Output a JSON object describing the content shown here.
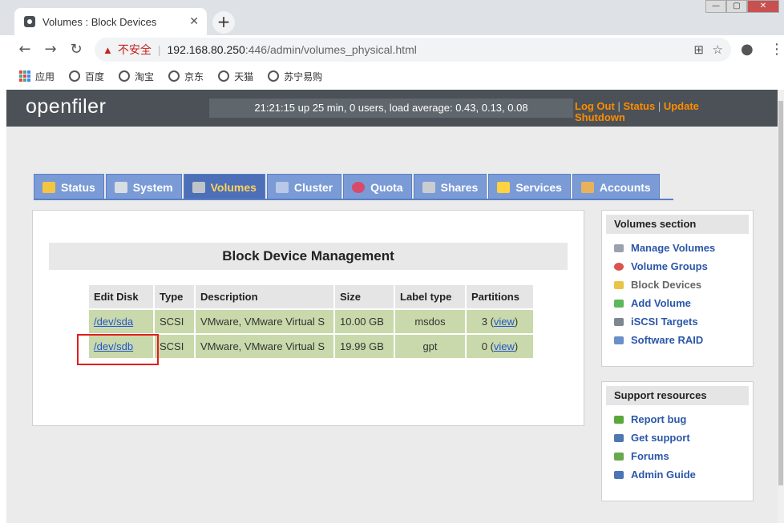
{
  "browser": {
    "tab_title": "Volumes : Block Devices",
    "tab_close": "✕",
    "new_tab": "+",
    "window_buttons": [
      "—",
      "▢",
      "✕"
    ],
    "nav": {
      "back": "←",
      "forward": "→",
      "reload": "↻"
    },
    "address": {
      "insecure_label": "不安全",
      "separator": "|",
      "host": "192.168.80.250",
      "rest": ":446/admin/volumes_physical.html"
    },
    "bookmarks": [
      {
        "label": "应用",
        "icon": "apps-icon"
      },
      {
        "label": "百度",
        "icon": "globe-icon"
      },
      {
        "label": "淘宝",
        "icon": "globe-icon"
      },
      {
        "label": "京东",
        "icon": "globe-icon"
      },
      {
        "label": "天猫",
        "icon": "globe-icon"
      },
      {
        "label": "苏宁易购",
        "icon": "globe-icon"
      }
    ]
  },
  "header": {
    "logo": "openfiler",
    "status_text": "21:21:15 up 25 min, 0 users, load average: 0.43, 0.13, 0.08",
    "links": {
      "logout": "Log Out",
      "status": "Status",
      "update": "Update",
      "shutdown": "Shutdown",
      "divider": "|"
    }
  },
  "tabs": [
    {
      "label": "Status",
      "icon": "status-icon",
      "color": "#f4c542"
    },
    {
      "label": "System",
      "icon": "system-icon",
      "color": "#d8dde4"
    },
    {
      "label": "Volumes",
      "icon": "volumes-icon",
      "color": "#c0c4c8",
      "active": true
    },
    {
      "label": "Cluster",
      "icon": "cluster-icon",
      "color": "#b8c8e6"
    },
    {
      "label": "Quota",
      "icon": "quota-icon",
      "color": "#d94a6a"
    },
    {
      "label": "Shares",
      "icon": "shares-icon",
      "color": "#c9cdd2"
    },
    {
      "label": "Services",
      "icon": "services-icon",
      "color": "#ffd23f"
    },
    {
      "label": "Accounts",
      "icon": "accounts-icon",
      "color": "#e8b25c"
    }
  ],
  "main": {
    "title": "Block Device Management",
    "columns": [
      "Edit Disk",
      "Type",
      "Description",
      "Size",
      "Label type",
      "Partitions"
    ],
    "rows": [
      {
        "disk": "/dev/sda",
        "type": "SCSI",
        "description": "VMware, VMware Virtual S",
        "size": "10.00 GB",
        "label_type": "msdos",
        "partitions_count": "3",
        "view": "view"
      },
      {
        "disk": "/dev/sdb",
        "type": "SCSI",
        "description": "VMware, VMware Virtual S",
        "size": "19.99 GB",
        "label_type": "gpt",
        "partitions_count": "0",
        "view": "view"
      }
    ]
  },
  "sidebar": {
    "volumes_title": "Volumes section",
    "volumes_items": [
      {
        "label": "Manage Volumes",
        "icon": "manage-volumes-icon",
        "color": "#9aa3ad"
      },
      {
        "label": "Volume Groups",
        "icon": "volume-groups-icon",
        "color": "#d9534f"
      },
      {
        "label": "Block Devices",
        "icon": "block-devices-icon",
        "color": "#e8c547",
        "current": true
      },
      {
        "label": "Add Volume",
        "icon": "add-volume-icon",
        "color": "#5cb85c"
      },
      {
        "label": "iSCSI Targets",
        "icon": "iscsi-targets-icon",
        "color": "#7d8790"
      },
      {
        "label": "Software RAID",
        "icon": "software-raid-icon",
        "color": "#6a8fc9"
      }
    ],
    "support_title": "Support resources",
    "support_items": [
      {
        "label": "Report bug",
        "icon": "bug-icon",
        "color": "#5aa83a"
      },
      {
        "label": "Get support",
        "icon": "support-icon",
        "color": "#4f78b3"
      },
      {
        "label": "Forums",
        "icon": "forums-icon",
        "color": "#6aa850"
      },
      {
        "label": "Admin Guide",
        "icon": "guide-icon",
        "color": "#4b74b8"
      }
    ]
  }
}
